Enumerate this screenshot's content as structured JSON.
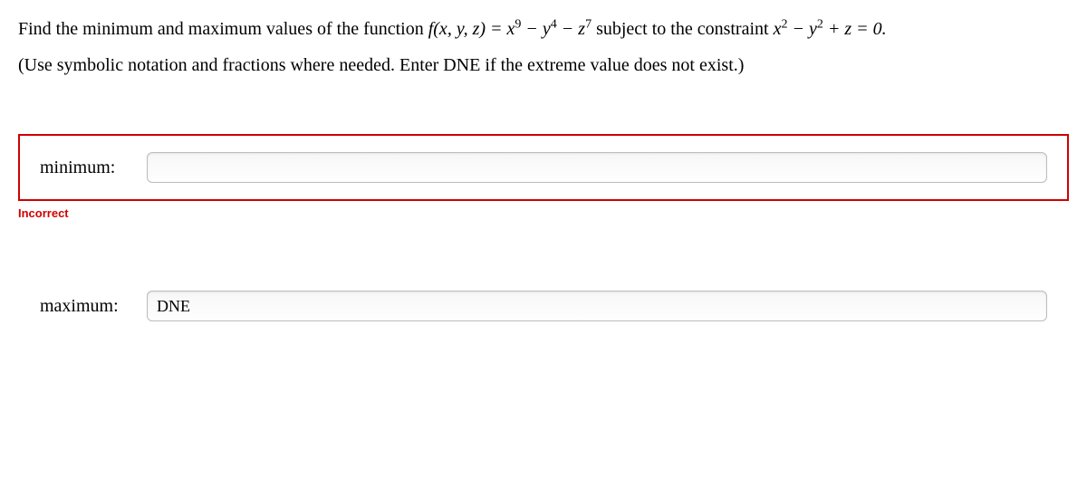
{
  "prompt": {
    "prefix": "Find the minimum and maximum values of the function ",
    "func": "f(x, y, z) = x",
    "e1": "9",
    "t1": " − y",
    "e2": "4",
    "t2": " − z",
    "e3": "7",
    "mid": " subject to the constraint ",
    "c1": "x",
    "ce1": "2",
    "ct1": " − y",
    "ce2": "2",
    "ct2": " + z = 0.",
    "hint": "(Use symbolic notation and fractions where needed. Enter DNE if the extreme value does not exist.)"
  },
  "answers": {
    "minimum": {
      "label": "minimum:",
      "value": "",
      "placeholder": ""
    },
    "maximum": {
      "label": "maximum:",
      "value": "DNE",
      "placeholder": ""
    }
  },
  "feedback": {
    "incorrect": "Incorrect"
  }
}
